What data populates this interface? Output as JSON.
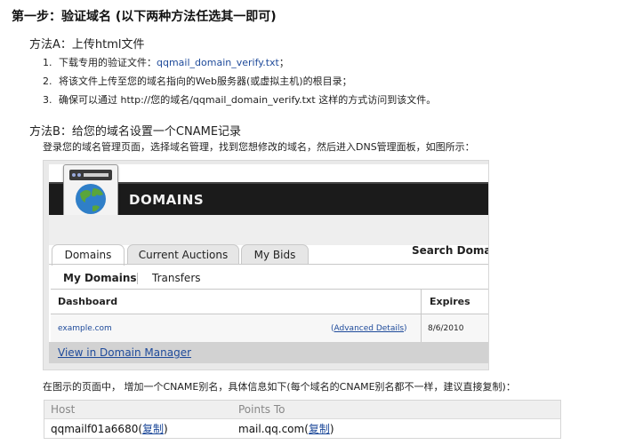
{
  "step": {
    "title": "第一步：验证域名 (以下两种方法任选其一即可)"
  },
  "method_a": {
    "title": "方法A：上传html文件",
    "steps": [
      {
        "num": "1.",
        "pre": "下载专用的验证文件：",
        "link": "qqmail_domain_verify.txt",
        "post": "；"
      },
      {
        "num": "2.",
        "text": "将该文件上传至您的域名指向的Web服务器(或虚拟主机)的根目录；"
      },
      {
        "num": "3.",
        "text": "确保可以通过 http://您的域名/qqmail_domain_verify.txt 这样的方式访问到该文件。"
      }
    ]
  },
  "method_b": {
    "title": "方法B：给您的域名设置一个CNAME记录",
    "instruction": "登录您的域名管理页面，选择域名管理，找到您想修改的域名，然后进入DNS管理面板，如图所示：",
    "screenshot": {
      "banner_title": "DOMAINS",
      "tabs": [
        "Domains",
        "Current Auctions",
        "My Bids"
      ],
      "search_label": "Search Domain",
      "subtabs": [
        "My Domains",
        "Transfers"
      ],
      "columns": [
        "Dashboard",
        "Expires"
      ],
      "row": {
        "domain": "example.com",
        "advanced": "Advanced Details",
        "expires": "8/6/2010"
      },
      "footer_link": "View in Domain Manager"
    },
    "instruction2": "在图示的页面中， 增加一个CNAME别名，具体信息如下(每个域名的CNAME别名都不一样，建议直接复制)：",
    "cname": {
      "headers": [
        "Host",
        "Points To"
      ],
      "host": "qqmailf01a6680",
      "points_to": "mail.qq.com",
      "copy_label": "复制"
    }
  },
  "colors": {
    "link": "#1e4a9a",
    "banner": "#1b1b1b",
    "footer": "#d2d2d2"
  }
}
